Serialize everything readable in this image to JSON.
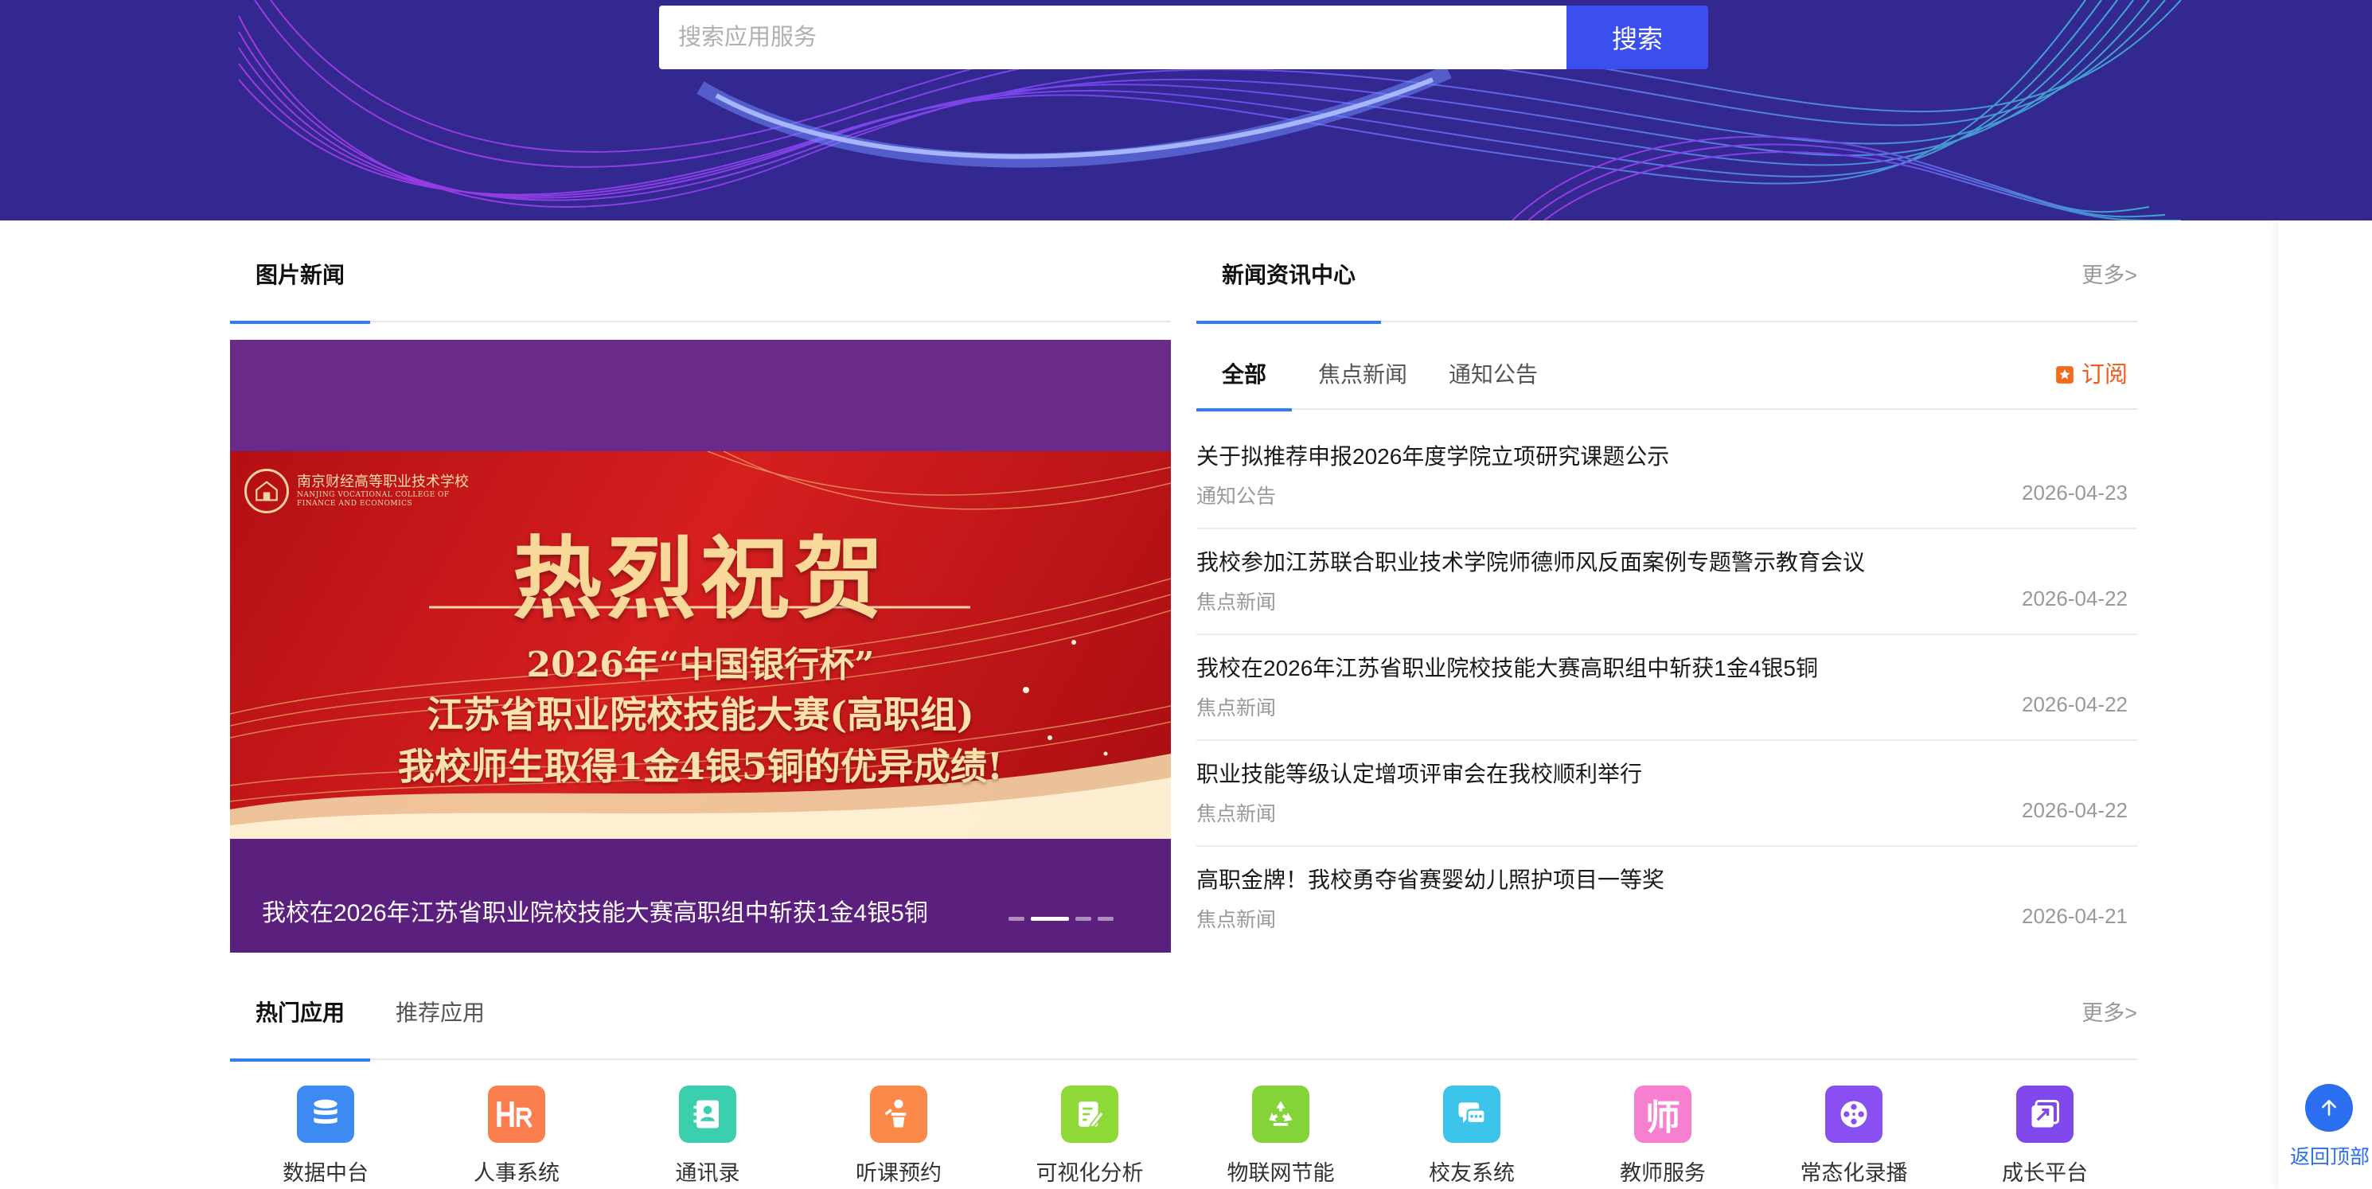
{
  "search": {
    "placeholder": "搜索应用服务",
    "button_label": "搜索"
  },
  "picture_news": {
    "tab_label": "图片新闻",
    "slide": {
      "school_name": "南京财经高等职业技术学校",
      "school_name_en_1": "NANJING VOCATIONAL COLLEGE OF",
      "school_name_en_2": "FINANCE AND ECONOMICS",
      "headline": "热烈祝贺",
      "line1": "2026年“中国银行杯”",
      "line2": "江苏省职业院校技能大赛(高职组)",
      "line3": "我校师生取得1金4银5铜的优异成绩!"
    },
    "caption": "我校在2026年江苏省职业院校技能大赛高职组中斩获1金4银5铜",
    "slide_count": 4,
    "active_slide": 2
  },
  "news_center": {
    "tab_label": "新闻资讯中心",
    "more_label": "更多>",
    "sub_tabs": [
      {
        "label": "全部",
        "active": true
      },
      {
        "label": "焦点新闻",
        "active": false
      },
      {
        "label": "通知公告",
        "active": false
      }
    ],
    "subscribe_label": "订阅",
    "items": [
      {
        "title": "关于拟推荐申报2026年度学院立项研究课题公示",
        "category": "通知公告",
        "date": "2026-04-23"
      },
      {
        "title": "我校参加江苏联合职业技术学院师德师风反面案例专题警示教育会议",
        "category": "焦点新闻",
        "date": "2026-04-22"
      },
      {
        "title": "我校在2026年江苏省职业院校技能大赛高职组中斩获1金4银5铜",
        "category": "焦点新闻",
        "date": "2026-04-22"
      },
      {
        "title": "职业技能等级认定增项评审会在我校顺利举行",
        "category": "焦点新闻",
        "date": "2026-04-22"
      },
      {
        "title": "高职金牌！我校勇夺省赛婴幼儿照护项目一等奖",
        "category": "焦点新闻",
        "date": "2026-04-21"
      }
    ]
  },
  "apps_section": {
    "tabs": [
      {
        "label": "热门应用",
        "active": true
      },
      {
        "label": "推荐应用",
        "active": false
      }
    ],
    "more_label": "更多>",
    "apps": [
      {
        "name": "数据中台",
        "icon": "database-icon",
        "color": "#3d8bf2"
      },
      {
        "name": "人事系统",
        "icon": "hr-icon",
        "color": "#fb7e4e"
      },
      {
        "name": "通讯录",
        "icon": "contacts-icon",
        "color": "#3ccfae"
      },
      {
        "name": "听课预约",
        "icon": "lecture-icon",
        "color": "#fb8a4a"
      },
      {
        "name": "可视化分析",
        "icon": "edit-chart-icon",
        "color": "#8ed838"
      },
      {
        "name": "物联网节能",
        "icon": "recycle-icon",
        "color": "#84d439"
      },
      {
        "name": "校友系统",
        "icon": "chat-icon",
        "color": "#3cc4ea"
      },
      {
        "name": "教师服务",
        "icon": "teacher-icon",
        "color": "#f77fd0",
        "glyph": "师"
      },
      {
        "name": "常态化录播",
        "icon": "film-reel-icon",
        "color": "#8a4ff0"
      },
      {
        "name": "成长平台",
        "icon": "growth-icon",
        "color": "#8048ec"
      }
    ]
  },
  "back_to_top": {
    "label": "返回顶部"
  }
}
